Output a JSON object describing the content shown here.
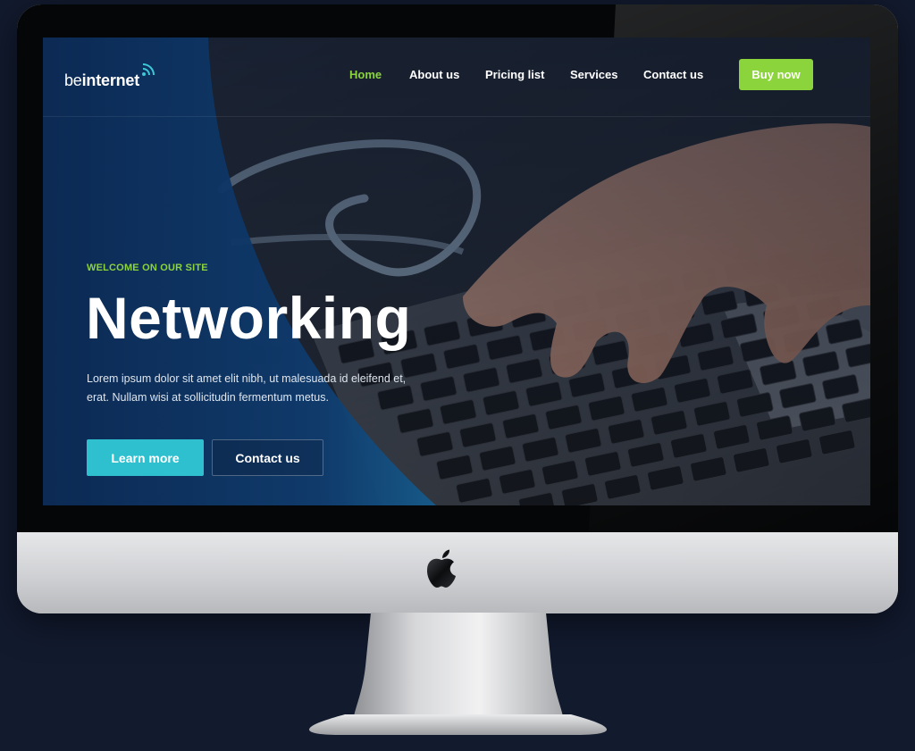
{
  "header": {
    "logo_prefix": "be",
    "logo_brand": "internet",
    "nav": [
      "Home",
      "About us",
      "Pricing list",
      "Services",
      "Contact us"
    ],
    "active_nav": "Home",
    "buy_label": "Buy now"
  },
  "hero": {
    "eyebrow": "WELCOME ON OUR SITE",
    "title": "Networking",
    "text_line1": "Lorem ipsum dolor sit amet elit nibh, ut malesuada id eleifend et,",
    "text_line2": "erat. Nullam wisi at sollicitudin fermentum metus.",
    "learn_label": "Learn more",
    "contact_label": "Contact us"
  },
  "colors": {
    "accent_green": "#8cd43c",
    "accent_cyan": "#2fc0cf",
    "page_background": "#121a2e",
    "panel_blue": "#0d2a52"
  },
  "icons": {
    "logo": "wifi-icon",
    "monitor": "apple-logo-icon"
  }
}
